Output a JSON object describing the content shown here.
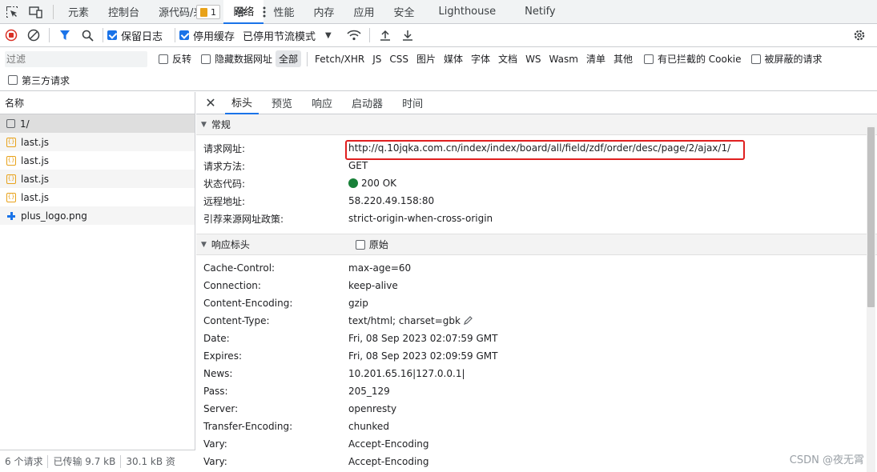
{
  "tabbar": {
    "tabs": [
      "元素",
      "控制台",
      "源代码/来源",
      "网络",
      "性能",
      "内存",
      "应用",
      "安全",
      "Lighthouse",
      "Netify"
    ],
    "active": "网络",
    "issues_count": "1"
  },
  "toolbar": {
    "preserve_log": "保留日志",
    "disable_cache": "停用缓存",
    "throttle": "已停用节流模式"
  },
  "filter": {
    "placeholder": "过滤",
    "invert": "反转",
    "hide_data_urls": "隐藏数据网址",
    "types": [
      "全部",
      "Fetch/XHR",
      "JS",
      "CSS",
      "图片",
      "媒体",
      "字体",
      "文档",
      "WS",
      "Wasm",
      "清单",
      "其他"
    ],
    "blocked_cookies": "有已拦截的 Cookie",
    "blocked_requests": "被屏蔽的请求",
    "third_party": "第三方请求"
  },
  "requests": {
    "header": "名称",
    "items": [
      {
        "name": "1/",
        "type": "doc"
      },
      {
        "name": "last.js",
        "type": "js"
      },
      {
        "name": "last.js",
        "type": "js"
      },
      {
        "name": "last.js",
        "type": "js"
      },
      {
        "name": "last.js",
        "type": "js"
      },
      {
        "name": "plus_logo.png",
        "type": "img"
      }
    ],
    "status": {
      "count": "6 个请求",
      "transferred": "已传输 9.7 kB",
      "resources": "30.1 kB 资"
    }
  },
  "details": {
    "tabs": [
      "标头",
      "预览",
      "响应",
      "启动器",
      "时间"
    ],
    "general": {
      "title": "常规",
      "rows": [
        {
          "k": "请求网址:",
          "v": "http://q.10jqka.com.cn/index/index/board/all/field/zdf/order/desc/page/2/ajax/1/"
        },
        {
          "k": "请求方法:",
          "v": "GET"
        },
        {
          "k": "状态代码:",
          "v": "200 OK"
        },
        {
          "k": "远程地址:",
          "v": "58.220.49.158:80"
        },
        {
          "k": "引荐来源网址政策:",
          "v": "strict-origin-when-cross-origin"
        }
      ]
    },
    "response": {
      "title": "响应标头",
      "raw": "原始",
      "rows": [
        {
          "k": "Cache-Control:",
          "v": "max-age=60"
        },
        {
          "k": "Connection:",
          "v": "keep-alive"
        },
        {
          "k": "Content-Encoding:",
          "v": "gzip"
        },
        {
          "k": "Content-Type:",
          "v": "text/html; charset=gbk"
        },
        {
          "k": "Date:",
          "v": "Fri, 08 Sep 2023 02:07:59 GMT"
        },
        {
          "k": "Expires:",
          "v": "Fri, 08 Sep 2023 02:09:59 GMT"
        },
        {
          "k": "News:",
          "v": "10.201.65.16|127.0.0.1|"
        },
        {
          "k": "Pass:",
          "v": "205_129"
        },
        {
          "k": "Server:",
          "v": "openresty"
        },
        {
          "k": "Transfer-Encoding:",
          "v": "chunked"
        },
        {
          "k": "Vary:",
          "v": "Accept-Encoding"
        },
        {
          "k": "Vary:",
          "v": "Accept-Encoding"
        }
      ]
    }
  },
  "watermark": "CSDN @夜无霄"
}
